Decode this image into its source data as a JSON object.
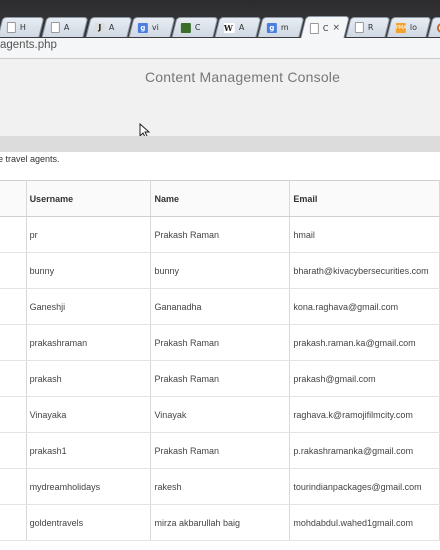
{
  "browser": {
    "tabs": [
      {
        "label": "H",
        "icon": "document-icon"
      },
      {
        "label": "A",
        "icon": "document-icon"
      },
      {
        "label": "A",
        "icon": "j-favicon"
      },
      {
        "label": "vi",
        "icon": "google-icon"
      },
      {
        "label": "C",
        "icon": "c-favicon"
      },
      {
        "label": "A",
        "icon": "wikipedia-icon"
      },
      {
        "label": "m",
        "icon": "google-icon"
      },
      {
        "label": "C",
        "icon": "document-icon",
        "active": true
      },
      {
        "label": "R",
        "icon": "document-icon"
      },
      {
        "label": "lo",
        "icon": "pma-icon"
      },
      {
        "label": "",
        "icon": "ring-icon"
      }
    ],
    "close_glyph": "×",
    "url": "agents.php"
  },
  "page": {
    "title": "Content Management Console",
    "intro": "e travel agents."
  },
  "table": {
    "headers": [
      "",
      "Username",
      "Name",
      "Email"
    ],
    "rows": [
      [
        "",
        "pr",
        "Prakash Raman",
        "hmail"
      ],
      [
        "",
        "bunny",
        "bunny",
        "bharath@kivacybersecurities.com"
      ],
      [
        "",
        "Ganeshji",
        "Gananadha",
        "kona.raghava@gmail.com"
      ],
      [
        "",
        "prakashraman",
        "Prakash Raman",
        "prakash.raman.ka@gmail.com"
      ],
      [
        "",
        "prakash",
        "Prakash Raman",
        "prakash@gmail.com"
      ],
      [
        "",
        "Vinayaka",
        "Vinayak",
        "raghava.k@ramojifilmcity.com"
      ],
      [
        "",
        "prakash1",
        "Prakash Raman",
        "p.rakashramanka@gmail.com"
      ],
      [
        "",
        "mydreamholidays",
        "rakesh",
        "tourindianpackages@gmail.com"
      ],
      [
        "",
        "goldentravels",
        "mirza akbarullah baig",
        "mohdabdul.wahed1gmail.com"
      ]
    ]
  }
}
